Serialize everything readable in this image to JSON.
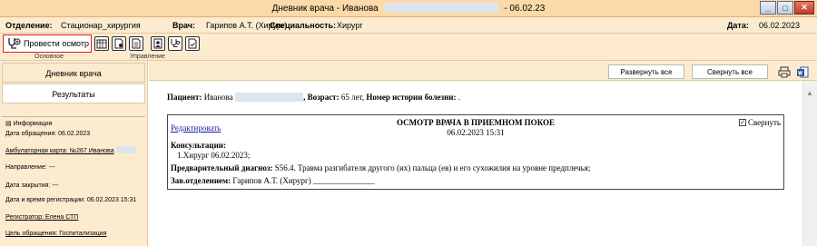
{
  "window": {
    "title_prefix": "Дневник врача - Иванова",
    "title_date": "- 06.02.23",
    "min_label": "_",
    "max_label": "□",
    "close_label": "✕"
  },
  "info": {
    "dept_label": "Отделение:",
    "dept_value": "Стационар_хирургия",
    "doctor_label": "Врач:",
    "doctor_value": "Гарипов А.Т. (Хирург)",
    "spec_label": "Специальность:",
    "spec_value": "Хирург",
    "date_label": "Дата:",
    "date_value": "06.02.2023"
  },
  "ribbon": {
    "exam_label": "Провести осмотр",
    "group_main": "Основное",
    "group_manage": "Управление"
  },
  "sidebar": {
    "diary_label": "Дневник врача",
    "results_label": "Результаты",
    "info_label": "Информация",
    "appeal_date": "Дата обращения: 06.02.2023",
    "amb_card": "Амбулаторная карта: №267 Иванова",
    "direction": "Направление: ---",
    "close_date": "Дата закрытия: ---",
    "reg_datetime": "Дата и время регистрации: 06.02.2023 15:31",
    "registrar": "Регистратор: Елена СТП",
    "purpose": "Цель обращения: Госпитализация"
  },
  "toolbar": {
    "expand_label": "Развернуть все",
    "collapse_label": "Свернуть все"
  },
  "patient": {
    "patient_label": "Пациент:",
    "patient_name": "Иванова",
    "age_label": "Возраст:",
    "age_value": "65 лет,",
    "history_label": "Номер истории болезни:",
    "history_value": "."
  },
  "exam": {
    "edit_label": "Редактировать",
    "heading": "ОСМОТР ВРАЧА В ПРИЕМНОМ ПОКОЕ",
    "datetime": "06.02.2023 15:31",
    "collapse_label": "Свернуть",
    "consult_label": "Консультации:",
    "consult_value": "1.Хирург 06.02.2023;",
    "diag_label": "Предварительный диагноз:",
    "diag_value": "S56.4. Травма разгибателя другого (их) пальца (ев) и его сухожилия на уровне предплечья;",
    "head_label": "Зав.отделением:",
    "head_value": "Гарипов А.Т. (Хирург) _______________"
  }
}
